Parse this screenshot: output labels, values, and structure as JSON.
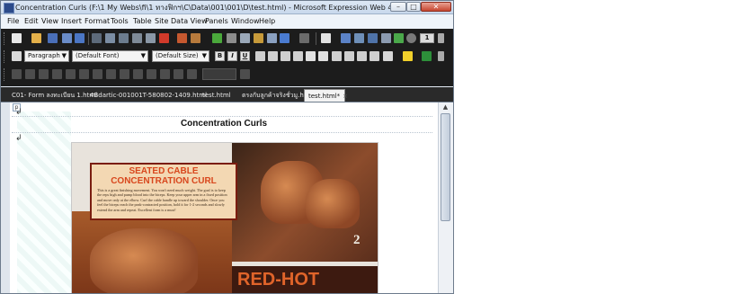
{
  "window": {
    "title": "Concentration Curls (F:\\1 My Webs\\fi\\1 ทางฟิกฯ\\C\\Data\\001\\001\\D\\test.html) - Microsoft Expression Web 4",
    "min_glyph": "–",
    "max_glyph": "□",
    "close_glyph": "✕"
  },
  "menu": [
    "File",
    "Edit",
    "View",
    "Insert",
    "Format",
    "Tools",
    "Table",
    "Site",
    "Data View",
    "Panels",
    "Window",
    "Help"
  ],
  "toolbar": {
    "style_value": "Paragraph",
    "font_value": "(Default Font)",
    "size_value": "(Default Size)",
    "bold_label": "B",
    "italic_label": "I",
    "underline_label": "U",
    "view_number": "1"
  },
  "tabs": [
    {
      "label": "C01- Form ลงทะเบียน 1.html",
      "active": false
    },
    {
      "label": "4Bdartic-001001T-580802-1409.html",
      "active": false
    },
    {
      "label": "test.html",
      "active": false
    },
    {
      "label": "ตรงกับลูกค้าจริงชั่วมู.html",
      "active": false
    },
    {
      "label": "test.html*",
      "active": true
    }
  ],
  "editor": {
    "p_tag": "p",
    "heading": "Concentration Curls",
    "image": {
      "card_title_1": "SEATED CABLE",
      "card_title_2": "CONCENTRATION CURL",
      "card_body": "This is a great finishing movement. You won't need much weight. The goal is to keep the reps high and pump blood into the biceps. Keep your upper arm in a fixed position and move only at the elbow. Curl the cable handle up toward the shoulder. Once you feel the biceps reach the peak-contracted position, hold it for 1-2 seconds and slowly extend the arm and repeat. Excellent form is a must!",
      "number": "2",
      "banner": "RED-HOT"
    }
  },
  "colors": {
    "toolbar_bg": "#1c1c1c",
    "accent_red": "#d8471d",
    "window_frame": "#e6edf6"
  }
}
